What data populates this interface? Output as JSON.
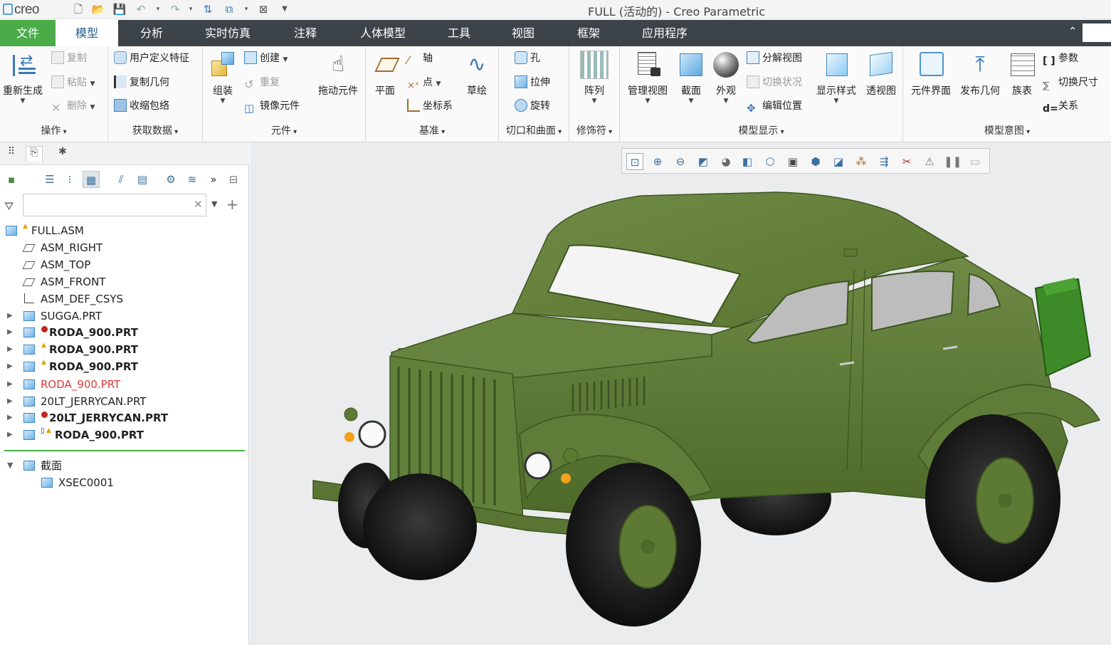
{
  "app": {
    "logo": "creo",
    "title": "FULL (活动的) - Creo Parametric"
  },
  "quick_access": [
    "new-icon",
    "open-icon",
    "save-icon",
    "undo-icon",
    "redo-icon",
    "regenerate-icon",
    "windows-icon",
    "close-window-icon",
    "customize-icon"
  ],
  "menu": {
    "tabs": [
      "文件",
      "模型",
      "分析",
      "实时仿真",
      "注释",
      "人体模型",
      "工具",
      "视图",
      "框架",
      "应用程序"
    ],
    "active": "模型"
  },
  "ribbon": {
    "operations": {
      "label": "操作",
      "regenerate": "重新生成",
      "copy": "复制",
      "paste": "粘贴",
      "delete": "删除"
    },
    "get_data": {
      "label": "获取数据",
      "udf": "用户定义特征",
      "copy_geom": "复制几何",
      "shrinkwrap": "收缩包络"
    },
    "component": {
      "label": "元件",
      "assemble": "组装",
      "create": "创建",
      "repeat": "重复",
      "mirror": "镜像元件",
      "drag": "拖动元件"
    },
    "datum": {
      "label": "基准",
      "plane": "平面",
      "axis": "轴",
      "point": "点",
      "csys": "坐标系",
      "sketch": "草绘"
    },
    "cut_surface": {
      "label": "切口和曲面",
      "hole": "孔",
      "extrude": "拉伸",
      "revolve": "旋转"
    },
    "modifiers": {
      "label": "修饰符",
      "pattern": "阵列"
    },
    "model_display": {
      "label": "模型显示",
      "manage_views": "管理视图",
      "section": "截面",
      "appearance": "外观",
      "explode": "分解视图",
      "toggle_status": "切换状况",
      "edit_position": "编辑位置",
      "display_style": "显示样式",
      "perspective": "透视图"
    },
    "model_intent": {
      "label": "模型意图",
      "component_interface": "元件界面",
      "publish_geom": "发布几何",
      "family_table": "族表",
      "parameters": "参数",
      "switch_dims": "切换尺寸",
      "relations": "关系"
    }
  },
  "model_tree": {
    "search_value": "",
    "items": [
      {
        "label": "FULL.ASM",
        "badge": "warn",
        "style": "normal"
      },
      {
        "label": "ASM_RIGHT",
        "style": "normal"
      },
      {
        "label": "ASM_TOP",
        "style": "normal"
      },
      {
        "label": "ASM_FRONT",
        "style": "normal"
      },
      {
        "label": "ASM_DEF_CSYS",
        "style": "normal"
      },
      {
        "label": "SUGGA.PRT",
        "style": "normal"
      },
      {
        "label": "RODA_900.PRT",
        "badge": "err",
        "style": "bold"
      },
      {
        "label": "RODA_900.PRT",
        "badge": "warn",
        "style": "bold"
      },
      {
        "label": "RODA_900.PRT",
        "badge": "warn",
        "style": "bold"
      },
      {
        "label": "RODA_900.PRT",
        "style": "red"
      },
      {
        "label": "20LT_JERRYCAN.PRT",
        "style": "normal"
      },
      {
        "label": "20LT_JERRYCAN.PRT",
        "badge": "err",
        "style": "bold"
      },
      {
        "label": "RODA_900.PRT",
        "badge": "warn",
        "style": "bold"
      }
    ],
    "sections_label": "截面",
    "section_item": "XSEC0001"
  },
  "colors": {
    "file_tab": "#4aab48",
    "menubar": "#3d4449",
    "body_green": "#5d7a34",
    "tire": "#1a1a1a"
  }
}
